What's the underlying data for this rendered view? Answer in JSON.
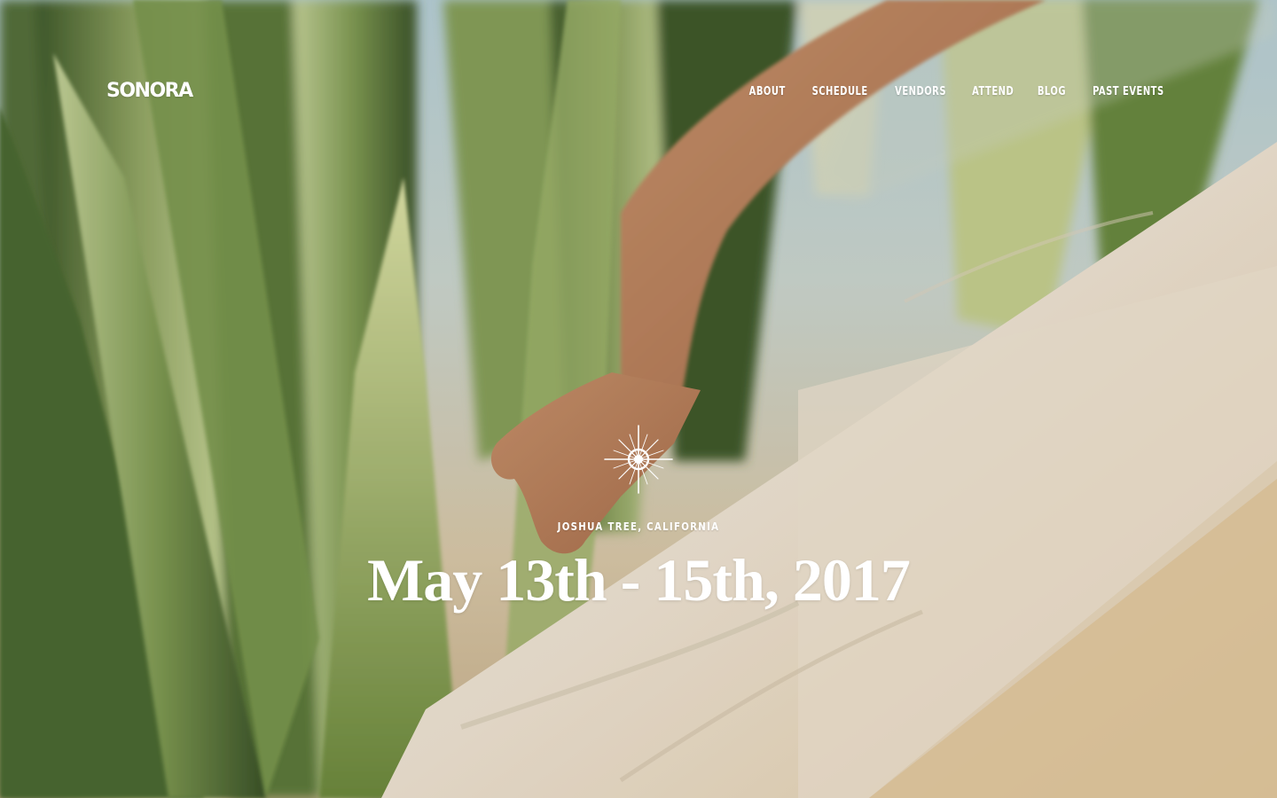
{
  "brand": {
    "logo_text": "SONORA"
  },
  "nav": {
    "items": [
      {
        "label": "About"
      },
      {
        "label": "Schedule"
      },
      {
        "label": "Vendors"
      },
      {
        "label": "Attend"
      },
      {
        "label": "Blog"
      },
      {
        "label": "Past Events"
      }
    ]
  },
  "hero": {
    "icon": "sunburst-icon",
    "location": "Joshua Tree, California",
    "dates": "May 13th - 15th, 2017"
  },
  "colors": {
    "text": "#ffffff",
    "agave_green": "#6f8548",
    "sky": "#b9d4dc",
    "cloth": "#efe5d6"
  }
}
